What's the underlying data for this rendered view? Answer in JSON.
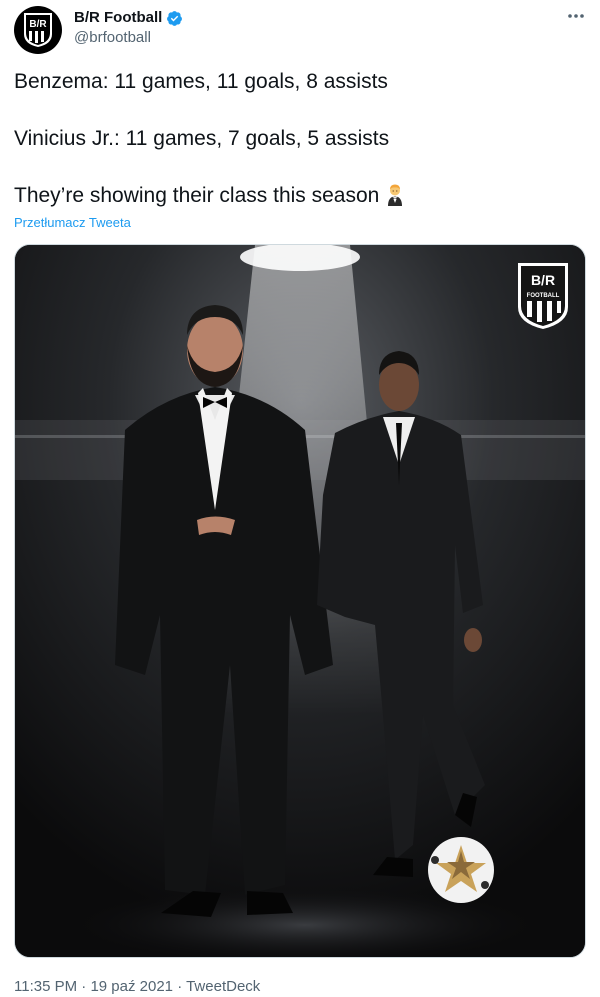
{
  "author": {
    "display_name": "B/R Football",
    "handle": "@brfootball",
    "verified": true,
    "avatar_text": "B/R"
  },
  "more_icon": "more-horizontal-icon",
  "tweet": {
    "lines": [
      "Benzema: 11 games, 11 goals, 8 assists",
      "Vinicius Jr.: 11 games, 7 goals, 5 assists",
      "They’re showing their class this season"
    ],
    "emoji": "person-in-tuxedo-emoji",
    "translate_label": "Przetłumacz Tweeta"
  },
  "media": {
    "logo_text": "B/R",
    "logo_sub": "FOOTBALL"
  },
  "meta": {
    "time": "11:35 PM",
    "date": "19 paź 2021",
    "separator": "·",
    "source": "TweetDeck"
  },
  "colors": {
    "link": "#1d9bf0",
    "secondary": "#536471",
    "verified": "#1d9bf0"
  }
}
